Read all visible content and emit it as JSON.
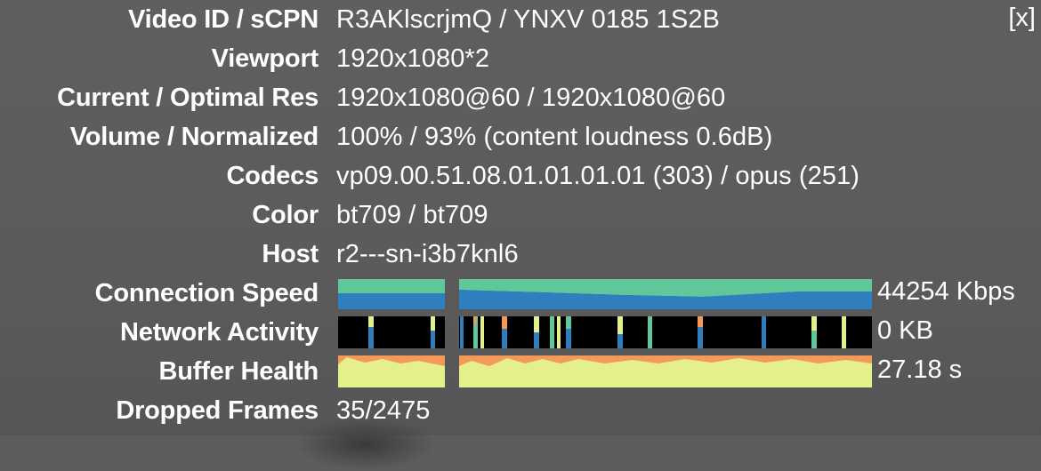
{
  "close_label": "[x]",
  "rows": [
    {
      "label": "Video ID / sCPN",
      "value": "R3AKlscrjmQ / YNXV 0185 1S2B"
    },
    {
      "label": "Viewport",
      "value": "1920x1080*2"
    },
    {
      "label": "Current / Optimal Res",
      "value": "1920x1080@60 / 1920x1080@60"
    },
    {
      "label": "Volume / Normalized",
      "value": "100% / 93% (content loudness 0.6dB)"
    },
    {
      "label": "Codecs",
      "value": "vp09.00.51.08.01.01.01.01 (303) / opus (251)"
    },
    {
      "label": "Color",
      "value": "bt709 / bt709"
    },
    {
      "label": "Host",
      "value": "r2---sn-i3b7knl6"
    }
  ],
  "graphs": {
    "connection_speed": {
      "label": "Connection Speed",
      "value": "44254 Kbps"
    },
    "network_activity": {
      "label": "Network Activity",
      "value": "0 KB"
    },
    "buffer_health": {
      "label": "Buffer Health",
      "value": "27.18 s"
    }
  },
  "dropped_frames": {
    "label": "Dropped Frames",
    "value": "35/2475"
  },
  "colors": {
    "speed_top": "#5fc79a",
    "speed_bottom": "#2f7fbf",
    "activity_bg": "#000000",
    "buffer_fill": "#e5ef8c",
    "buffer_edge": "#f39a5a"
  }
}
